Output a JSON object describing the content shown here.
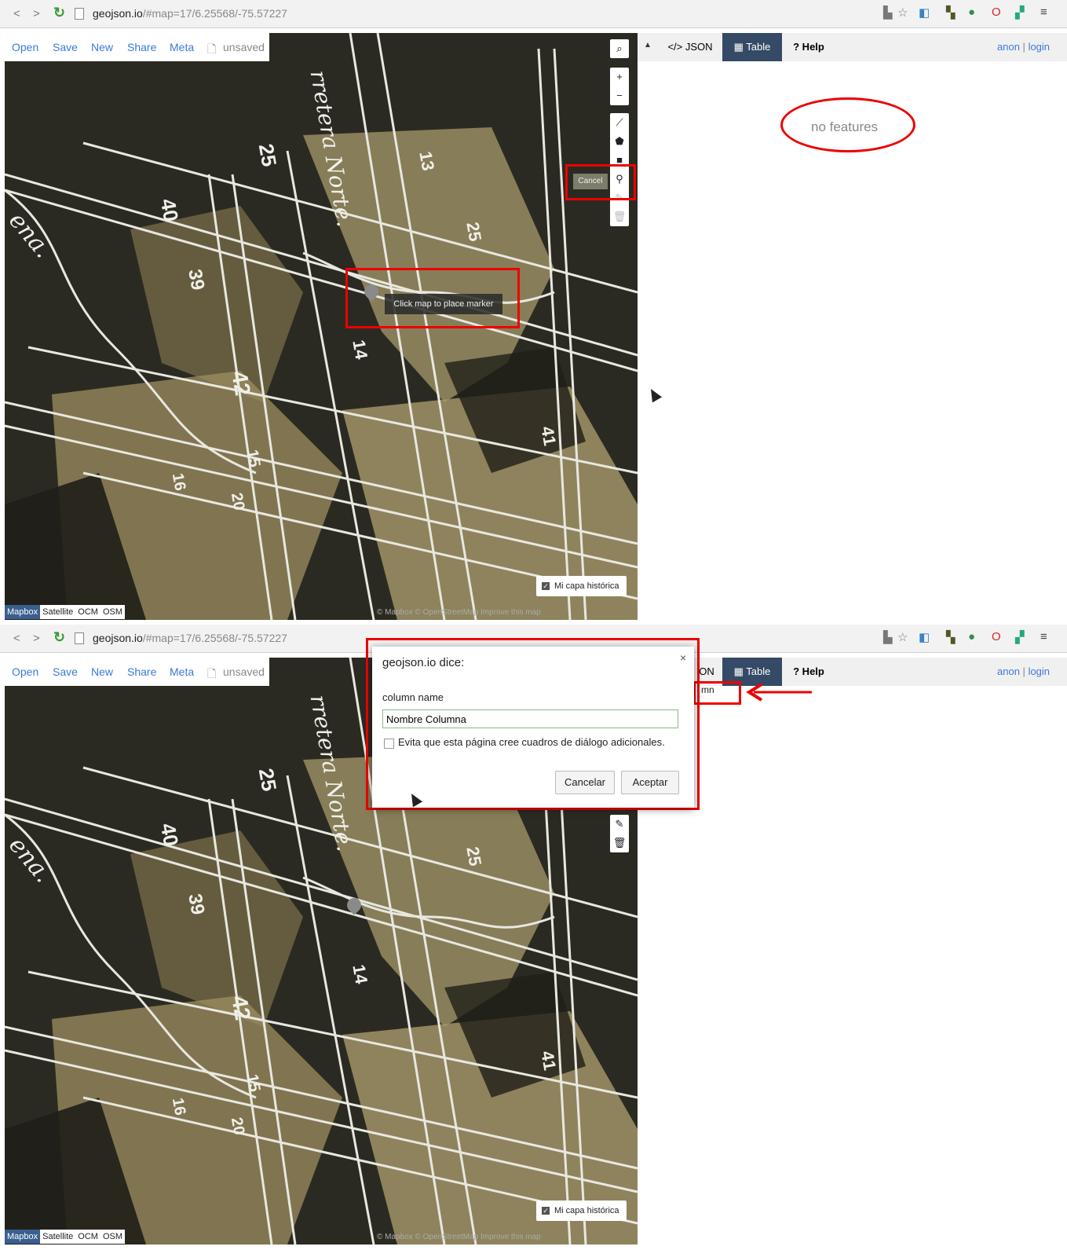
{
  "browser": {
    "back_icon": "chevron-left-icon",
    "forward_icon": "chevron-right-icon",
    "reload_icon": "reload-icon",
    "url_host": "geojson.io",
    "url_rest": "/#map=17/6.25568/-75.57227"
  },
  "toolbar": {
    "open": "Open",
    "save": "Save",
    "new": "New",
    "share": "Share",
    "meta": "Meta",
    "unsaved": "unsaved"
  },
  "map_controls": {
    "zoom_in": "+",
    "zoom_out": "−",
    "cancel": "Cancel",
    "tooltip": "Click map to place marker",
    "layer_toggle": "Mi capa histórica",
    "base_layers": [
      "Mapbox",
      "Satellite",
      "OCM",
      "OSM"
    ],
    "attribution": "© Mapbox © OpenStreetMap Improve this map",
    "street_labels": [
      "rretera Norte.",
      "25",
      "13",
      "40",
      "ena.",
      "25",
      "39",
      "14",
      "42",
      "15",
      "16",
      "20",
      "41"
    ]
  },
  "panel": {
    "tabs": [
      "</> JSON",
      "Table",
      "? Help"
    ],
    "tab_partial": "ON",
    "anon": "anon",
    "separator": "|",
    "login": "login",
    "empty": "no features",
    "column_hint": "mn"
  },
  "dialog": {
    "title": "geojson.io dice:",
    "close": "×",
    "label": "column name",
    "value": "Nombre Columna",
    "checkbox_label": "Evita que esta página cree cuadros de diálogo adicionales.",
    "cancel": "Cancelar",
    "accept": "Aceptar"
  },
  "colors": {
    "link": "#3a7bd5",
    "active_tab": "#354a66",
    "annotation": "#e00000",
    "map_dark": "#2b2a22",
    "map_parcel": "#a89a6c"
  }
}
